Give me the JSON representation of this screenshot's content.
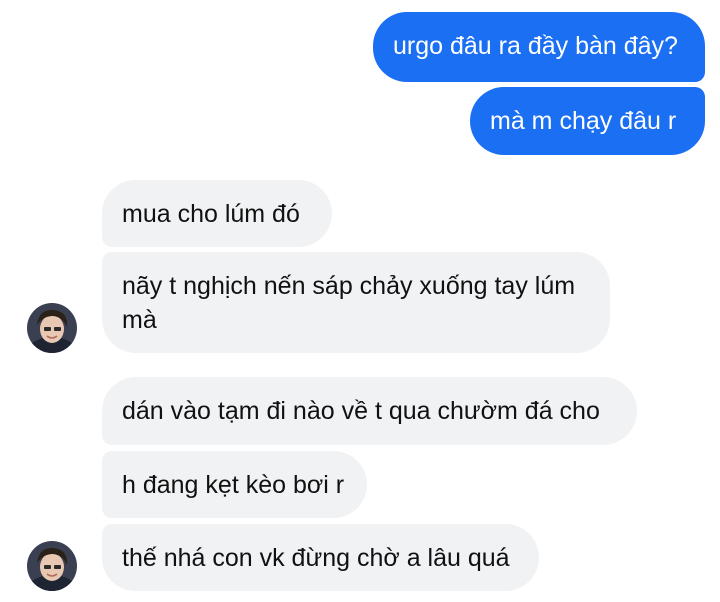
{
  "conversation": {
    "outgoing": [
      {
        "text": "urgo đâu ra đầy bàn đây?"
      },
      {
        "text": "mà m chạy đâu r"
      }
    ],
    "incoming": [
      {
        "text": "mua cho lúm đó"
      },
      {
        "text": "nãy t nghịch nến sáp chảy xuống tay lúm mà"
      },
      {
        "text": "dán vào tạm đi nào về t qua chườm đá cho"
      },
      {
        "text": "h đang kẹt kèo bơi r"
      },
      {
        "text": "thế nhá con vk đừng chờ a lâu quá"
      }
    ]
  },
  "colors": {
    "outgoing_bubble": "#1a6ff2",
    "incoming_bubble": "#f1f2f4",
    "background": "#ffffff"
  },
  "icons": {
    "avatar": "contact-avatar-icon"
  }
}
